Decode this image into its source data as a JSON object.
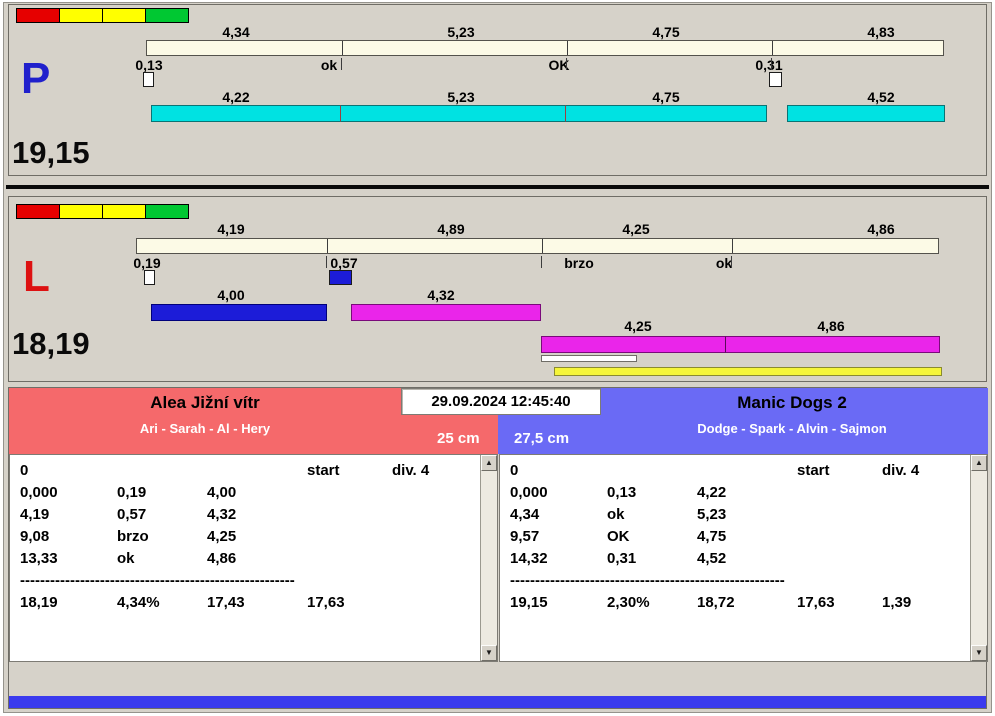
{
  "start_lights": [
    "#e60000",
    "#ffff00",
    "#ffff00",
    "#00c832"
  ],
  "colors": {
    "left_header": "#f5696b",
    "right_header": "#6a6af5",
    "cyan_bar": "#00e2e2",
    "blue_bar": "#1c1cd8",
    "magenta_bar": "#ea25ea",
    "cream_bar": "#fcfae6",
    "yellow_bar": "#f5f53a",
    "bottom_accent": "#3a3aee",
    "letter_p": "#2020cc",
    "letter_l": "#dd1111"
  },
  "lane_p": {
    "letter": "P",
    "total": "19,15",
    "upper_values": [
      "4,34",
      "5,23",
      "4,75",
      "4,83"
    ],
    "split_labels": [
      "0,13",
      "ok",
      "OK",
      "0,31"
    ],
    "lower_values": [
      "4,22",
      "5,23",
      "4,75",
      "4,52"
    ]
  },
  "lane_l": {
    "letter": "L",
    "total": "18,19",
    "upper_values": [
      "4,19",
      "4,89",
      "4,25",
      "4,86"
    ],
    "split_labels": [
      "0,19",
      "0,57",
      "brzo",
      "ok"
    ],
    "row1_values": [
      "4,00",
      "4,32"
    ],
    "row2_values": [
      "4,25",
      "4,86"
    ]
  },
  "scoreboard": {
    "datetime": "29.09.2024 12:45:40",
    "left": {
      "team": "Alea Jižní vítr",
      "members": "Ari - Sarah - Al - Hery",
      "jump_height": "25 cm",
      "rows": [
        [
          "0",
          "",
          "",
          "start",
          "div. 4"
        ],
        [
          "0,000",
          "0,19",
          "4,00",
          "",
          ""
        ],
        [
          "4,19",
          "0,57",
          "4,32",
          "",
          ""
        ],
        [
          "9,08",
          "brzo",
          "4,25",
          "",
          ""
        ],
        [
          "13,33",
          "ok",
          "4,86",
          "",
          ""
        ],
        [
          "-------------------------------------------------------"
        ],
        [
          "18,19",
          "4,34%",
          "17,43",
          "17,63",
          ""
        ]
      ]
    },
    "right": {
      "team": "Manic Dogs 2",
      "members": "Dodge - Spark - Alvin - Sajmon",
      "jump_height": "27,5 cm",
      "rows": [
        [
          "0",
          "",
          "",
          "start",
          "div. 4"
        ],
        [
          "0,000",
          "0,13",
          "4,22",
          "",
          ""
        ],
        [
          "4,34",
          "ok",
          "5,23",
          "",
          ""
        ],
        [
          "9,57",
          "OK",
          "4,75",
          "",
          ""
        ],
        [
          "14,32",
          "0,31",
          "4,52",
          "",
          ""
        ],
        [
          "-------------------------------------------------------"
        ],
        [
          "19,15",
          "2,30%",
          "18,72",
          "17,63",
          "1,39"
        ]
      ]
    }
  }
}
